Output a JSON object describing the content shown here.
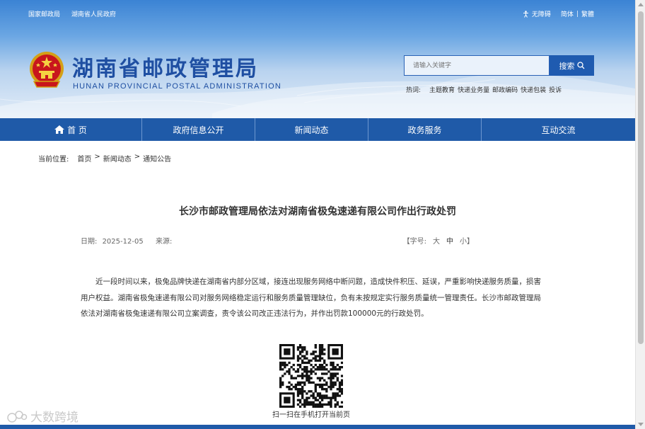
{
  "top_links": [
    "国家邮政局",
    "湖南省人民政府"
  ],
  "toolbox": {
    "accessibility": "无障碍",
    "simplified": "简体",
    "separator": "|",
    "traditional": "繁體"
  },
  "site": {
    "title": "湖南省邮政管理局",
    "subtitle": "HUNAN PROVINCIAL POSTAL ADMINISTRATION"
  },
  "search": {
    "placeholder": "请输入关键字",
    "button": "搜索"
  },
  "hotwords": {
    "label": "热词:",
    "items": [
      "主题教育",
      "快递业务量",
      "邮政编码",
      "快递包装",
      "投诉"
    ]
  },
  "nav": [
    "首 页",
    "政府信息公开",
    "新闻动态",
    "政务服务",
    "互动交流"
  ],
  "breadcrumb": {
    "label": "当前位置:",
    "items": [
      "首页",
      ">",
      "新闻动态",
      ">",
      "通知公告"
    ]
  },
  "article": {
    "title": "长沙市邮政管理局依法对湖南省极兔速递有限公司作出行政处罚",
    "date_label": "日期:",
    "date": "2025-12-05",
    "source_label": "来源:",
    "font_size": {
      "open": "【字号:",
      "large": "大",
      "medium": "中",
      "small": "小",
      "close": "】"
    },
    "body": "近一段时间以来，极兔品牌快递在湖南省内部分区域，接连出现服务网络中断问题，造成快件积压、延误，严重影响快递服务质量，损害用户权益。湖南省极兔速递有限公司对服务网络稳定运行和服务质量管理缺位，负有未按规定实行服务质量统一管理责任。长沙市邮政管理局依法对湖南省极兔速递有限公司立案调查，责令该公司改正违法行为，并作出罚款100000元的行政处罚。"
  },
  "qr": {
    "caption": "扫一扫在手机打开当前页"
  },
  "watermark": "大数跨境",
  "colors": {
    "nav": "#1f5aa8",
    "title_blue": "#1f4fa2",
    "search_button": "#1f5bb0"
  },
  "icons": {
    "accessibility": "accessibility-icon",
    "home": "home-icon",
    "search": "search-icon",
    "emblem": "national-emblem-icon"
  }
}
